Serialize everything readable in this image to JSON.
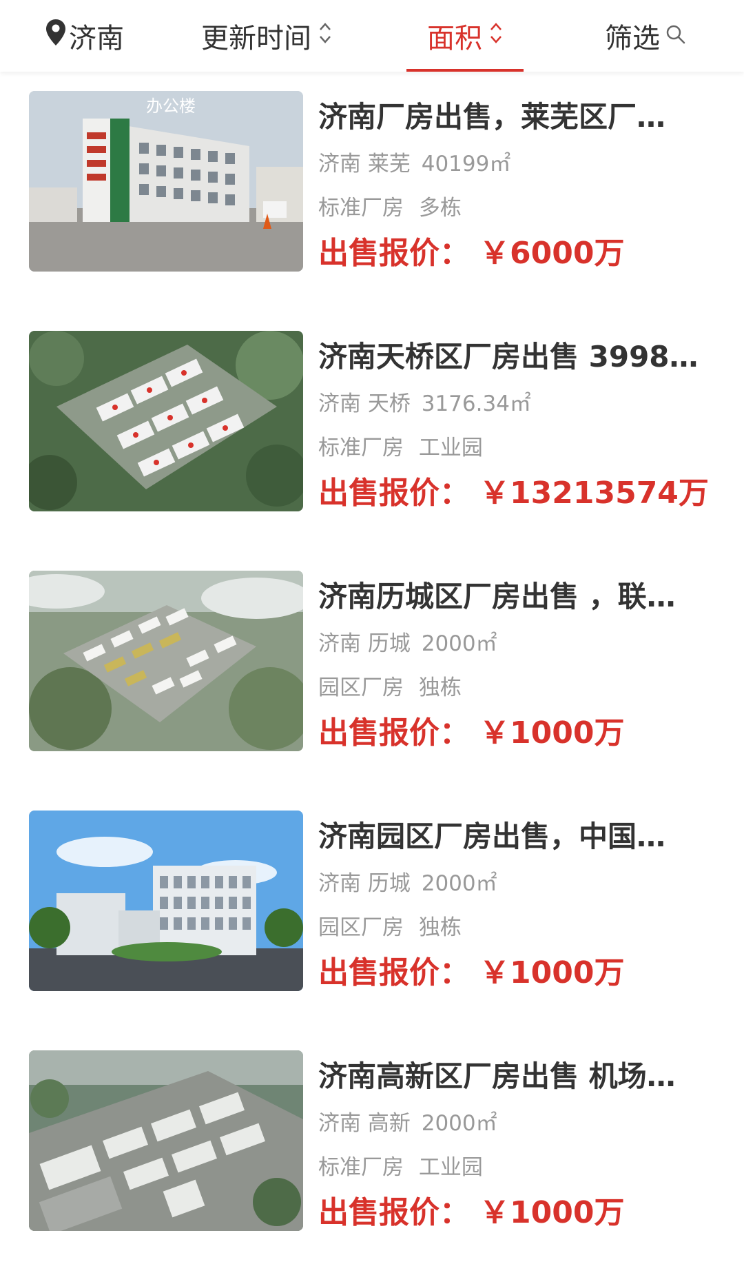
{
  "filter_bar": {
    "city_label": "济南",
    "update_time_label": "更新时间",
    "area_label": "面积",
    "filter_label": "筛选"
  },
  "colors": {
    "accent": "#d8322b",
    "text_primary": "#333333",
    "text_secondary": "#999999"
  },
  "listings": [
    {
      "title": "济南厂房出售，莱芜区厂…",
      "city": "济南",
      "district": "莱芜",
      "area": "40199㎡",
      "tags": [
        "标准厂房",
        "多栋"
      ],
      "price_label": "出售报价：",
      "price": "￥6000万",
      "image_text": "办公楼"
    },
    {
      "title": "济南天桥区厂房出售 3998…",
      "city": "济南",
      "district": "天桥",
      "area": "3176.34㎡",
      "tags": [
        "标准厂房",
        "工业园"
      ],
      "price_label": "出售报价：",
      "price": "￥13213574万"
    },
    {
      "title": "济南历城区厂房出售 ，联…",
      "city": "济南",
      "district": "历城",
      "area": "2000㎡",
      "tags": [
        "园区厂房",
        "独栋"
      ],
      "price_label": "出售报价：",
      "price": "￥1000万"
    },
    {
      "title": "济南园区厂房出售，中国…",
      "city": "济南",
      "district": "历城",
      "area": "2000㎡",
      "tags": [
        "园区厂房",
        "独栋"
      ],
      "price_label": "出售报价：",
      "price": "￥1000万"
    },
    {
      "title": "济南高新区厂房出售 机场…",
      "city": "济南",
      "district": "高新",
      "area": "2000㎡",
      "tags": [
        "标准厂房",
        "工业园"
      ],
      "price_label": "出售报价：",
      "price": "￥1000万"
    }
  ]
}
